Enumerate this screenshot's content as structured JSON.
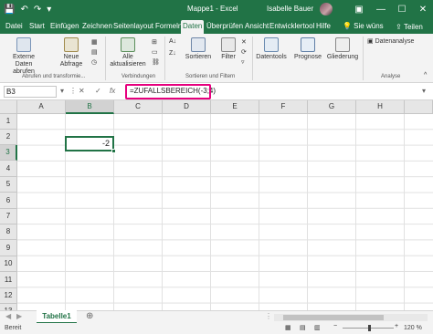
{
  "titlebar": {
    "doc_title": "Mappe1  -  Excel",
    "user_name": "Isabelle Bauer",
    "minimize": "—",
    "maximize": "☐",
    "close": "✕",
    "qat": [
      "💾",
      "↶",
      "↷",
      "▾"
    ]
  },
  "tabs": [
    "Datei",
    "Start",
    "Einfügen",
    "Zeichnen",
    "Seitenlayout",
    "Formeln",
    "Daten",
    "Überprüfen",
    "Ansicht",
    "Entwicklertool",
    "Hilfe"
  ],
  "tellme": "💡 Sie wüns",
  "share": "⇪ Teilen",
  "ribbon": {
    "external_data": "Externe Daten abrufen",
    "new_query": "Neue Abfrage",
    "refresh_all": "Alle aktualisieren",
    "sort": "Sortieren",
    "filter": "Filter",
    "datatools": "Datentools",
    "forecast": "Prognose",
    "outline": "Gliederung",
    "data_analysis": "Datenanalyse",
    "group_labels": [
      "Abrufen und transformie...",
      "Verbindungen",
      "Sortieren und Filtern",
      "Analyse"
    ]
  },
  "formula_bar": {
    "name_box": "B3",
    "icons": [
      "⋮",
      "✕",
      "✓",
      "fx"
    ],
    "formula": "=ZUFALLSBEREICH(-3;4)"
  },
  "grid": {
    "columns": [
      "A",
      "B",
      "C",
      "D",
      "E",
      "F",
      "G",
      "H"
    ],
    "rows": [
      "1",
      "2",
      "3",
      "4",
      "5",
      "6",
      "7",
      "8",
      "9",
      "10",
      "11",
      "12",
      "13"
    ],
    "active_value": "-2"
  },
  "sheet": {
    "tab": "Tabelle1",
    "add": "⊕",
    "nav": [
      "◀",
      "▶"
    ]
  },
  "status": {
    "text": "Bereit",
    "zoom": "120 %"
  },
  "colors": {
    "brand": "#217346",
    "highlight": "#e6007e"
  }
}
